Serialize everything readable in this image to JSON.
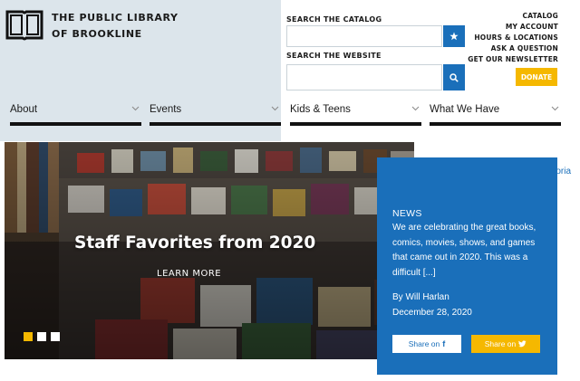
{
  "brand": {
    "line1": "THE PUBLIC LIBRARY",
    "line2": "OF BROOKLINE"
  },
  "search": {
    "catalog_label": "SEARCH THE CATALOG",
    "catalog_value": "",
    "website_label": "SEARCH THE WEBSITE",
    "website_value": ""
  },
  "quick_links": [
    {
      "label": "CATALOG"
    },
    {
      "label": "MY ACCOUNT"
    },
    {
      "label": "HOURS & LOCATIONS"
    },
    {
      "label": "ASK A QUESTION"
    },
    {
      "label": "GET OUR NEWSLETTER"
    }
  ],
  "donate_label": "DONATE",
  "nav": [
    {
      "label": "About"
    },
    {
      "label": "Events"
    },
    {
      "label": "Kids & Teens"
    },
    {
      "label": "What We Have"
    }
  ],
  "hero": {
    "title": "Staff Favorites from 2020",
    "cta": "LEARN MORE"
  },
  "card": {
    "kicker": "NEWS",
    "body": "We are celebrating the great books, comics, movies, shows, and games that came out in 2020. This was a difficult [...]",
    "author": "By Will Harlan",
    "date": "December 28, 2020",
    "share_facebook": "Share on",
    "share_twitter": "Share on"
  },
  "peek_text": "utoria",
  "colors": {
    "header_bg": "#dce5eb",
    "accent_blue": "#1a6fba",
    "accent_yellow": "#f5b800"
  }
}
